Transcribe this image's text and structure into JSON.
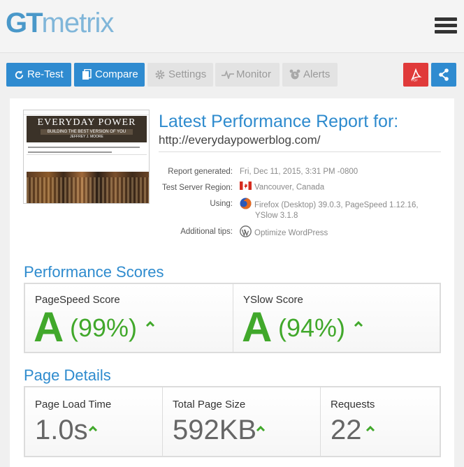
{
  "app": {
    "logo_gt": "GT",
    "logo_metrix": "metrix"
  },
  "toolbar": {
    "retest": "Re-Test",
    "compare": "Compare",
    "settings": "Settings",
    "monitor": "Monitor",
    "alerts": "Alerts",
    "pdf_icon": "pdf-icon",
    "share_icon": "share-icon"
  },
  "report": {
    "title": "Latest Performance Report for:",
    "url": "http://everydaypowerblog.com/",
    "thumbnail": {
      "site_name": "EVERYDAY POWER",
      "tagline": "BUILDING THE BEST VERSION OF YOU",
      "author": "JEFFREY J. MOORE"
    },
    "meta": [
      {
        "label": "Report generated:",
        "value": "Fri, Dec 11, 2015, 3:31 PM -0800",
        "icon": ""
      },
      {
        "label": "Test Server Region:",
        "value": "Vancouver, Canada",
        "icon": "canada-flag-icon"
      },
      {
        "label": "Using:",
        "value": "Firefox (Desktop) 39.0.3, PageSpeed 1.12.16,",
        "value2": "YSlow 3.1.8",
        "icon": "firefox-icon"
      },
      {
        "label": "Additional tips:",
        "value": "Optimize WordPress",
        "icon": "wordpress-icon"
      }
    ]
  },
  "scores": {
    "title": "Performance Scores",
    "pagespeed": {
      "label": "PageSpeed Score",
      "grade": "A",
      "percent": "(99%)"
    },
    "yslow": {
      "label": "YSlow Score",
      "grade": "A",
      "percent": "(94%)"
    }
  },
  "details": {
    "title": "Page Details",
    "load_time": {
      "label": "Page Load Time",
      "value": "1.0s"
    },
    "page_size": {
      "label": "Total Page Size",
      "value": "592KB"
    },
    "requests": {
      "label": "Requests",
      "value": "22"
    }
  },
  "colors": {
    "accent_blue": "#2f8bd0",
    "grade_green": "#41a82b",
    "pdf_red": "#e03a3a"
  }
}
